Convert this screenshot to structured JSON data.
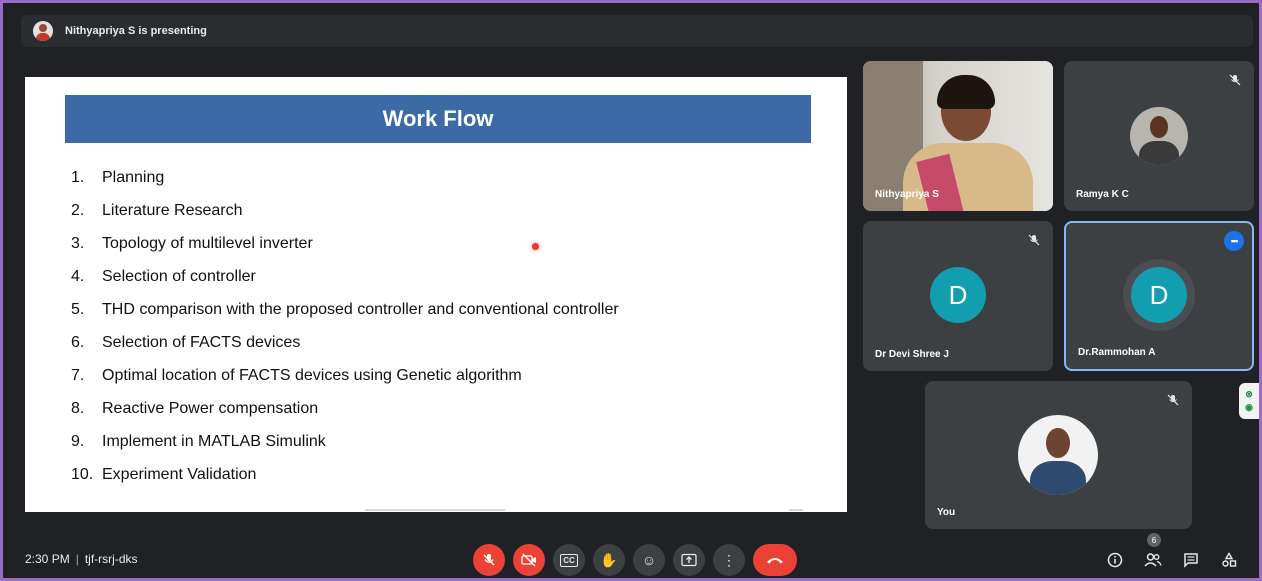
{
  "top_bar": {
    "presenting_text": "Nithyapriya S is presenting"
  },
  "slide": {
    "title": "Work Flow",
    "items": [
      {
        "num": "1.",
        "text": "Planning"
      },
      {
        "num": "2.",
        "text": "Literature Research"
      },
      {
        "num": "3.",
        "text": "Topology of multilevel inverter"
      },
      {
        "num": "4.",
        "text": "Selection of controller"
      },
      {
        "num": "5.",
        "text": "THD comparison with the proposed controller and conventional controller"
      },
      {
        "num": "6.",
        "text": "Selection of FACTS devices"
      },
      {
        "num": "7.",
        "text": "Optimal location of FACTS devices using Genetic algorithm"
      },
      {
        "num": "8.",
        "text": "Reactive Power compensation"
      },
      {
        "num": "9.",
        "text": "Implement in MATLAB Simulink"
      },
      {
        "num": "10.",
        "text": "Experiment Validation"
      }
    ]
  },
  "participants": [
    {
      "name": "Nithyapriya S",
      "type": "camera"
    },
    {
      "name": "Ramya K C",
      "type": "photo",
      "muted": true
    },
    {
      "name": "Dr Devi Shree J",
      "type": "letter",
      "letter": "D",
      "muted": true
    },
    {
      "name": "Dr.Rammohan A",
      "type": "letter",
      "letter": "D",
      "speaking": true
    },
    {
      "name": "You",
      "type": "photo",
      "muted": true
    }
  ],
  "bottom_bar": {
    "time": "2:30 PM",
    "meeting_code": "tjf-rsrj-dks",
    "participant_count": "6",
    "captions_label": "CC"
  },
  "colors": {
    "accent": "#8ab4f8",
    "danger": "#ea4335",
    "avatar": "#129eaf",
    "slide_title_bg": "#3c6aa6",
    "window_border": "#9b6bc6"
  }
}
